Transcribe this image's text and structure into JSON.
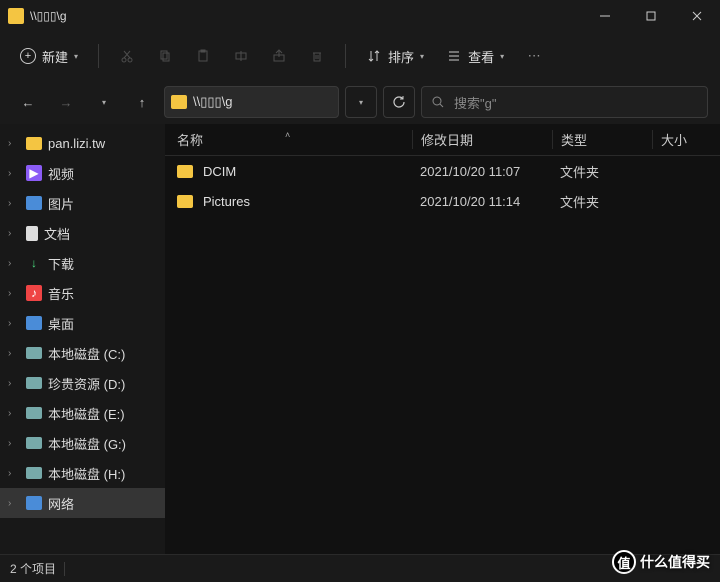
{
  "window": {
    "title": "\\\\▯▯▯\\g"
  },
  "toolbar": {
    "new_label": "新建",
    "sort_label": "排序",
    "view_label": "查看"
  },
  "address": {
    "path": "\\\\▯▯▯\\g"
  },
  "search": {
    "placeholder": "搜索\"g\""
  },
  "sidebar": {
    "items": [
      {
        "label": "pan.lizi.tw",
        "icon": "folder"
      },
      {
        "label": "视频",
        "icon": "video"
      },
      {
        "label": "图片",
        "icon": "picture"
      },
      {
        "label": "文档",
        "icon": "document"
      },
      {
        "label": "下载",
        "icon": "download"
      },
      {
        "label": "音乐",
        "icon": "music"
      },
      {
        "label": "桌面",
        "icon": "desktop"
      },
      {
        "label": "本地磁盘 (C:)",
        "icon": "disk"
      },
      {
        "label": "珍贵资源 (D:)",
        "icon": "disk"
      },
      {
        "label": "本地磁盘 (E:)",
        "icon": "disk"
      },
      {
        "label": "本地磁盘 (G:)",
        "icon": "disk"
      },
      {
        "label": "本地磁盘 (H:)",
        "icon": "disk"
      },
      {
        "label": "网络",
        "icon": "network",
        "selected": true
      }
    ]
  },
  "columns": {
    "name": "名称",
    "date": "修改日期",
    "type": "类型",
    "size": "大小"
  },
  "files": [
    {
      "name": "DCIM",
      "date": "2021/10/20 11:07",
      "type": "文件夹"
    },
    {
      "name": "Pictures",
      "date": "2021/10/20 11:14",
      "type": "文件夹"
    }
  ],
  "status": {
    "count_text": "2 个项目"
  },
  "watermark": {
    "badge": "值",
    "text": "什么值得买"
  }
}
